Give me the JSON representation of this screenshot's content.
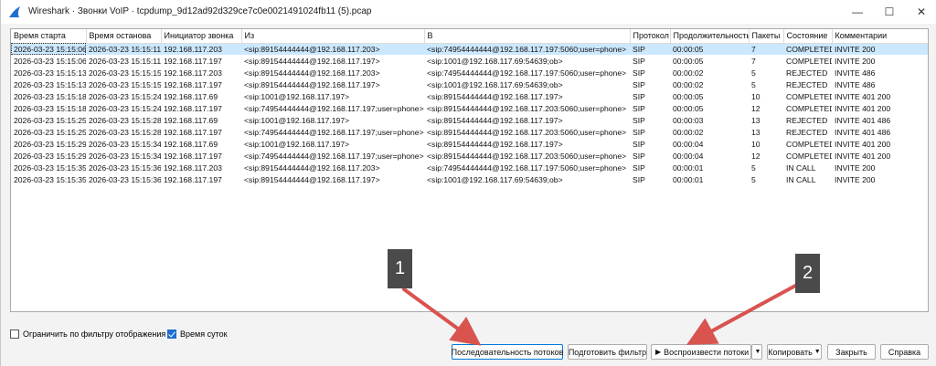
{
  "window": {
    "title": "Wireshark · Звонки VoIP · tcpdump_9d12ad92d329ce7c0e0021491024fb11 (5).pcap",
    "minimize": "—",
    "maximize": "☐",
    "close": "✕"
  },
  "table": {
    "columns": [
      "Время старта",
      "Время останова",
      "Инициатор звонка",
      "Из",
      "В",
      "Протокол",
      "Продолжительность",
      "Пакеты",
      "Состояние",
      "Комментарии"
    ],
    "rows": [
      [
        "2026-03-23 15:15:06",
        "2026-03-23 15:15:11",
        "192.168.117.203",
        "<sip:89154444444@192.168.117.203>",
        "<sip:74954444444@192.168.117.197:5060;user=phone>",
        "SIP",
        "00:00:05",
        "7",
        "COMPLETED",
        "INVITE 200"
      ],
      [
        "2026-03-23 15:15:06",
        "2026-03-23 15:15:11",
        "192.168.117.197",
        "<sip:89154444444@192.168.117.197>",
        "<sip:1001@192.168.117.69:54639;ob>",
        "SIP",
        "00:00:05",
        "7",
        "COMPLETED",
        "INVITE 200"
      ],
      [
        "2026-03-23 15:15:13",
        "2026-03-23 15:15:15",
        "192.168.117.203",
        "<sip:89154444444@192.168.117.203>",
        "<sip:74954444444@192.168.117.197:5060;user=phone>",
        "SIP",
        "00:00:02",
        "5",
        "REJECTED",
        "INVITE 486"
      ],
      [
        "2026-03-23 15:15:13",
        "2026-03-23 15:15:15",
        "192.168.117.197",
        "<sip:89154444444@192.168.117.197>",
        "<sip:1001@192.168.117.69:54639;ob>",
        "SIP",
        "00:00:02",
        "5",
        "REJECTED",
        "INVITE 486"
      ],
      [
        "2026-03-23 15:15:18",
        "2026-03-23 15:15:24",
        "192.168.117.69",
        "<sip:1001@192.168.117.197>",
        "<sip:89154444444@192.168.117.197>",
        "SIP",
        "00:00:05",
        "10",
        "COMPLETED",
        "INVITE 401 200"
      ],
      [
        "2026-03-23 15:15:18",
        "2026-03-23 15:15:24",
        "192.168.117.197",
        "<sip:74954444444@192.168.117.197;user=phone>",
        "<sip:89154444444@192.168.117.203:5060;user=phone>",
        "SIP",
        "00:00:05",
        "12",
        "COMPLETED",
        "INVITE 401 200"
      ],
      [
        "2026-03-23 15:15:25",
        "2026-03-23 15:15:28",
        "192.168.117.69",
        "<sip:1001@192.168.117.197>",
        "<sip:89154444444@192.168.117.197>",
        "SIP",
        "00:00:03",
        "13",
        "REJECTED",
        "INVITE 401 486"
      ],
      [
        "2026-03-23 15:15:25",
        "2026-03-23 15:15:28",
        "192.168.117.197",
        "<sip:74954444444@192.168.117.197;user=phone>",
        "<sip:89154444444@192.168.117.203:5060;user=phone>",
        "SIP",
        "00:00:02",
        "13",
        "REJECTED",
        "INVITE 401 486"
      ],
      [
        "2026-03-23 15:15:29",
        "2026-03-23 15:15:34",
        "192.168.117.69",
        "<sip:1001@192.168.117.197>",
        "<sip:89154444444@192.168.117.197>",
        "SIP",
        "00:00:04",
        "10",
        "COMPLETED",
        "INVITE 401 200"
      ],
      [
        "2026-03-23 15:15:29",
        "2026-03-23 15:15:34",
        "192.168.117.197",
        "<sip:74954444444@192.168.117.197;user=phone>",
        "<sip:89154444444@192.168.117.203:5060;user=phone>",
        "SIP",
        "00:00:04",
        "12",
        "COMPLETED",
        "INVITE 401 200"
      ],
      [
        "2026-03-23 15:15:35",
        "2026-03-23 15:15:36",
        "192.168.117.203",
        "<sip:89154444444@192.168.117.203>",
        "<sip:74954444444@192.168.117.197:5060;user=phone>",
        "SIP",
        "00:00:01",
        "5",
        "IN CALL",
        "INVITE 200"
      ],
      [
        "2026-03-23 15:15:35",
        "2026-03-23 15:15:36",
        "192.168.117.197",
        "<sip:89154444444@192.168.117.197>",
        "<sip:1001@192.168.117.69:54639;ob>",
        "SIP",
        "00:00:01",
        "5",
        "IN CALL",
        "INVITE 200"
      ]
    ]
  },
  "options": {
    "limit_filter_label": "Ограничить по фильтру отображения",
    "limit_filter_checked": false,
    "time_of_day_label": "Время суток",
    "time_of_day_checked": true
  },
  "buttons": {
    "flow_sequence": "Последовательность потоков",
    "prepare_filter": "Подготовить фильтр",
    "play_streams": "Воспроизвести потоки",
    "copy": "Копировать",
    "close": "Закрыть",
    "help": "Справка"
  },
  "annotations": {
    "badge1": "1",
    "badge2": "2",
    "arrow_color": "#d9534f"
  }
}
